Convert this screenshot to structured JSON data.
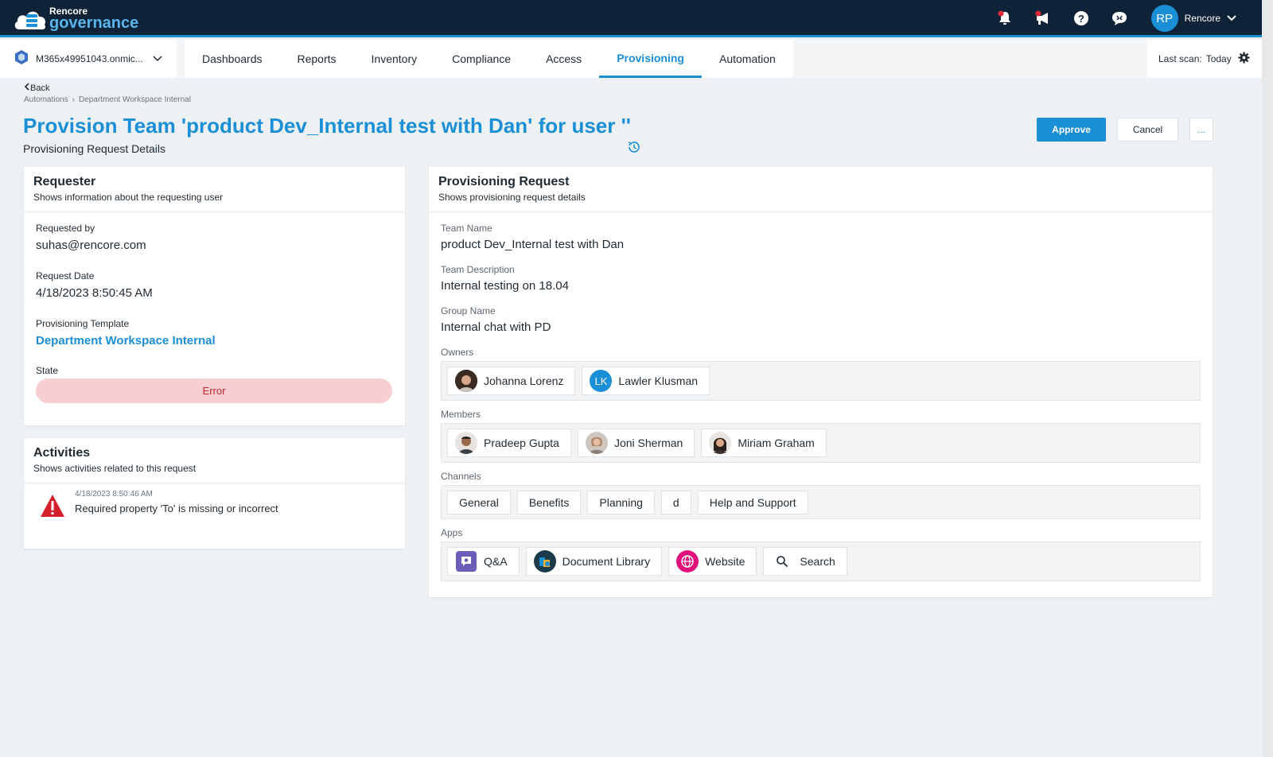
{
  "brand": {
    "line1": "Rencore",
    "line2": "governance"
  },
  "topbar": {
    "avatar_initials": "RP",
    "user_name": "Rencore"
  },
  "tenant": {
    "label": "M365x49951043.onmic..."
  },
  "tabs": [
    {
      "label": "Dashboards"
    },
    {
      "label": "Reports"
    },
    {
      "label": "Inventory"
    },
    {
      "label": "Compliance"
    },
    {
      "label": "Access"
    },
    {
      "label": "Provisioning"
    },
    {
      "label": "Automation"
    }
  ],
  "last_scan": {
    "label": "Last scan:",
    "value": "Today"
  },
  "back_label": "Back",
  "breadcrumb": {
    "item1": "Automations",
    "item2": "Department Workspace Internal"
  },
  "page": {
    "title": "Provision Team 'product Dev_Internal test with Dan' for user ''",
    "subtitle": "Provisioning Request Details"
  },
  "actions": {
    "approve": "Approve",
    "cancel": "Cancel",
    "more": "..."
  },
  "requester": {
    "title": "Requester",
    "subtitle": "Shows information about the requesting user",
    "requested_by_label": "Requested by",
    "requested_by": "suhas@rencore.com",
    "request_date_label": "Request Date",
    "request_date": "4/18/2023 8:50:45 AM",
    "template_label": "Provisioning Template",
    "template": "Department Workspace Internal",
    "state_label": "State",
    "state": "Error"
  },
  "activities": {
    "title": "Activities",
    "subtitle": "Shows activities related to this request",
    "items": [
      {
        "time": "4/18/2023 8:50:46 AM",
        "message": "Required property 'To' is missing or incorrect"
      }
    ]
  },
  "provisioning": {
    "title": "Provisioning Request",
    "subtitle": "Shows provisioning request details",
    "team_name_label": "Team Name",
    "team_name": "product Dev_Internal test with Dan",
    "team_desc_label": "Team Description",
    "team_desc": "Internal testing on 18.04",
    "group_name_label": "Group Name",
    "group_name": "Internal chat with PD",
    "owners_label": "Owners",
    "owners": [
      {
        "name": "Johanna Lorenz"
      },
      {
        "name": "Lawler Klusman",
        "initials": "LK"
      }
    ],
    "members_label": "Members",
    "members": [
      {
        "name": "Pradeep Gupta"
      },
      {
        "name": "Joni Sherman"
      },
      {
        "name": "Miriam Graham"
      }
    ],
    "channels_label": "Channels",
    "channels": [
      "General",
      "Benefits",
      "Planning",
      "d",
      "Help and Support"
    ],
    "apps_label": "Apps",
    "apps": [
      {
        "name": "Q&A",
        "icon": "qa-icon"
      },
      {
        "name": "Document Library",
        "icon": "document-library-icon"
      },
      {
        "name": "Website",
        "icon": "globe-icon"
      },
      {
        "name": "Search",
        "icon": "search-icon"
      }
    ]
  },
  "colors": {
    "accent": "#1a8fd6",
    "topbar": "#0f2338",
    "error_bg": "#f7cfd2",
    "error_text": "#c0232f"
  }
}
